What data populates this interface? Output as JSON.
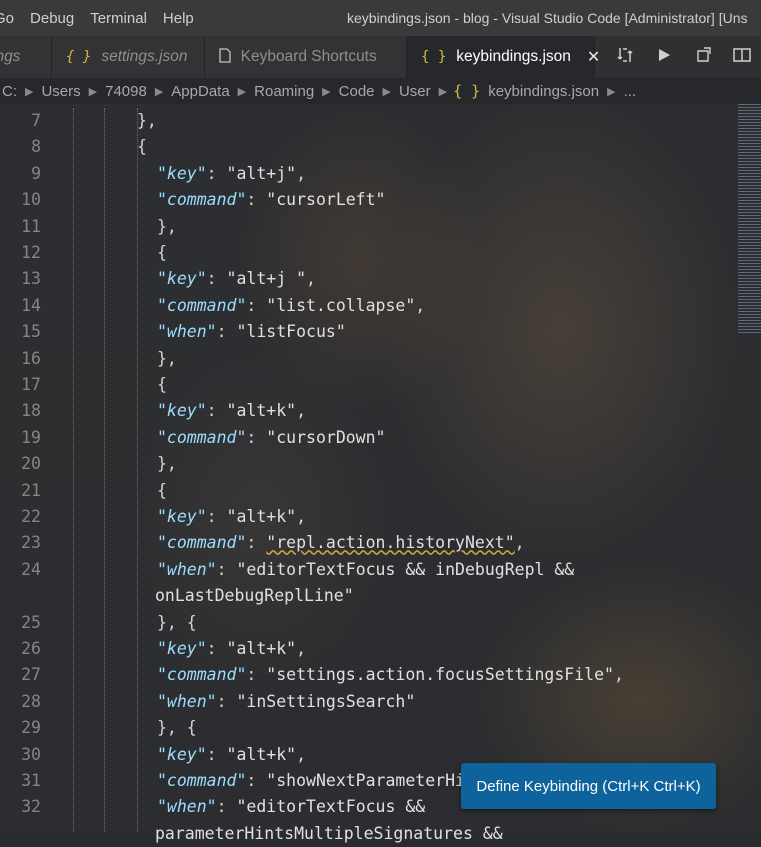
{
  "window": {
    "title": "keybindings.json - blog - Visual Studio Code [Administrator] [Uns",
    "menus": [
      "Go",
      "Debug",
      "Terminal",
      "Help"
    ]
  },
  "tabs": [
    {
      "label": "ings",
      "icon": "json-icon",
      "active": false
    },
    {
      "label": "settings.json",
      "icon": "json-icon",
      "active": false
    },
    {
      "label": "Keyboard Shortcuts",
      "icon": "file-icon",
      "active": false
    },
    {
      "label": "keybindings.json",
      "icon": "json-icon",
      "active": true,
      "close": "✕"
    }
  ],
  "tab_actions": [
    "compare-icon",
    "run-icon",
    "open-preview-icon",
    "split-editor-icon"
  ],
  "breadcrumb": [
    "C:",
    "Users",
    "74098",
    "AppData",
    "Roaming",
    "Code",
    "User",
    "keybindings.json",
    "..."
  ],
  "editor": {
    "lines": [
      {
        "n": "7",
        "parts": [
          [
            "p",
            "},"
          ]
        ],
        "indent": 1
      },
      {
        "n": "8",
        "parts": [
          [
            "p",
            "{"
          ]
        ],
        "indent": 1
      },
      {
        "n": "9",
        "parts": [
          [
            "k",
            "\"key\""
          ],
          [
            "p",
            ": "
          ],
          [
            "s",
            "\"alt+j\""
          ],
          [
            "p",
            ","
          ]
        ],
        "indent": 2
      },
      {
        "n": "10",
        "parts": [
          [
            "k",
            "\"command\""
          ],
          [
            "p",
            ": "
          ],
          [
            "s",
            "\"cursorLeft\""
          ]
        ],
        "indent": 2
      },
      {
        "n": "11",
        "parts": [
          [
            "p",
            "},"
          ]
        ],
        "indent": 2
      },
      {
        "n": "12",
        "parts": [
          [
            "p",
            "{"
          ]
        ],
        "indent": 2
      },
      {
        "n": "13",
        "parts": [
          [
            "k",
            "\"key\""
          ],
          [
            "p",
            ": "
          ],
          [
            "s",
            "\"alt+j \""
          ],
          [
            "p",
            ","
          ]
        ],
        "indent": 2
      },
      {
        "n": "14",
        "parts": [
          [
            "k",
            "\"command\""
          ],
          [
            "p",
            ": "
          ],
          [
            "s",
            "\"list.collapse\""
          ],
          [
            "p",
            ","
          ]
        ],
        "indent": 2
      },
      {
        "n": "15",
        "parts": [
          [
            "k",
            "\"when\""
          ],
          [
            "p",
            ": "
          ],
          [
            "s",
            "\"listFocus\""
          ]
        ],
        "indent": 2
      },
      {
        "n": "16",
        "parts": [
          [
            "p",
            "},"
          ]
        ],
        "indent": 2
      },
      {
        "n": "17",
        "parts": [
          [
            "p",
            "{"
          ]
        ],
        "indent": 2
      },
      {
        "n": "18",
        "parts": [
          [
            "k",
            "\"key\""
          ],
          [
            "p",
            ": "
          ],
          [
            "s",
            "\"alt+k\""
          ],
          [
            "p",
            ","
          ]
        ],
        "indent": 2
      },
      {
        "n": "19",
        "parts": [
          [
            "k",
            "\"command\""
          ],
          [
            "p",
            ": "
          ],
          [
            "s",
            "\"cursorDown\""
          ]
        ],
        "indent": 2
      },
      {
        "n": "20",
        "parts": [
          [
            "p",
            "},"
          ]
        ],
        "indent": 2
      },
      {
        "n": "21",
        "parts": [
          [
            "p",
            "{"
          ]
        ],
        "indent": 2
      },
      {
        "n": "22",
        "parts": [
          [
            "k",
            "\"key\""
          ],
          [
            "p",
            ": "
          ],
          [
            "s",
            "\"alt+k\""
          ],
          [
            "p",
            ","
          ]
        ],
        "indent": 2
      },
      {
        "n": "23",
        "parts": [
          [
            "k",
            "\"command\""
          ],
          [
            "p",
            ": "
          ],
          [
            "w",
            "\"repl.action.historyNext\""
          ],
          [
            "p",
            ","
          ]
        ],
        "indent": 2
      },
      {
        "n": "24",
        "parts": [
          [
            "k",
            "\"when\""
          ],
          [
            "p",
            ": "
          ],
          [
            "s",
            "\"editorTextFocus && inDebugRepl &&"
          ]
        ],
        "indent": 2
      },
      {
        "n": "",
        "parts": [
          [
            "s",
            "onLastDebugReplLine\""
          ]
        ],
        "indent": 2
      },
      {
        "n": "25",
        "parts": [
          [
            "p",
            "}, {"
          ]
        ],
        "indent": 2
      },
      {
        "n": "26",
        "parts": [
          [
            "k",
            "\"key\""
          ],
          [
            "p",
            ": "
          ],
          [
            "s",
            "\"alt+k\""
          ],
          [
            "p",
            ","
          ]
        ],
        "indent": 2
      },
      {
        "n": "27",
        "parts": [
          [
            "k",
            "\"command\""
          ],
          [
            "p",
            ": "
          ],
          [
            "s",
            "\"settings.action.focusSettingsFile\""
          ],
          [
            "p",
            ","
          ]
        ],
        "indent": 2
      },
      {
        "n": "28",
        "parts": [
          [
            "k",
            "\"when\""
          ],
          [
            "p",
            ": "
          ],
          [
            "s",
            "\"inSettingsSearch\""
          ]
        ],
        "indent": 2
      },
      {
        "n": "29",
        "parts": [
          [
            "p",
            "}, {"
          ]
        ],
        "indent": 2
      },
      {
        "n": "30",
        "parts": [
          [
            "k",
            "\"key\""
          ],
          [
            "p",
            ": "
          ],
          [
            "s",
            "\"alt+k\""
          ],
          [
            "p",
            ","
          ]
        ],
        "indent": 2
      },
      {
        "n": "31",
        "parts": [
          [
            "k",
            "\"command\""
          ],
          [
            "p",
            ": "
          ],
          [
            "s",
            "\"showNextParameterHint\""
          ],
          [
            "p",
            ","
          ]
        ],
        "indent": 2
      },
      {
        "n": "32",
        "parts": [
          [
            "k",
            "\"when\""
          ],
          [
            "p",
            ": "
          ],
          [
            "s",
            "\"editorTextFocus &&"
          ]
        ],
        "indent": 2
      },
      {
        "n": "",
        "parts": [
          [
            "s",
            "parameterHintsMultipleSignatures &&"
          ]
        ],
        "indent": 2
      }
    ]
  },
  "define_keybinding": {
    "label": "Define Keybinding (Ctrl+K Ctrl+K)"
  }
}
